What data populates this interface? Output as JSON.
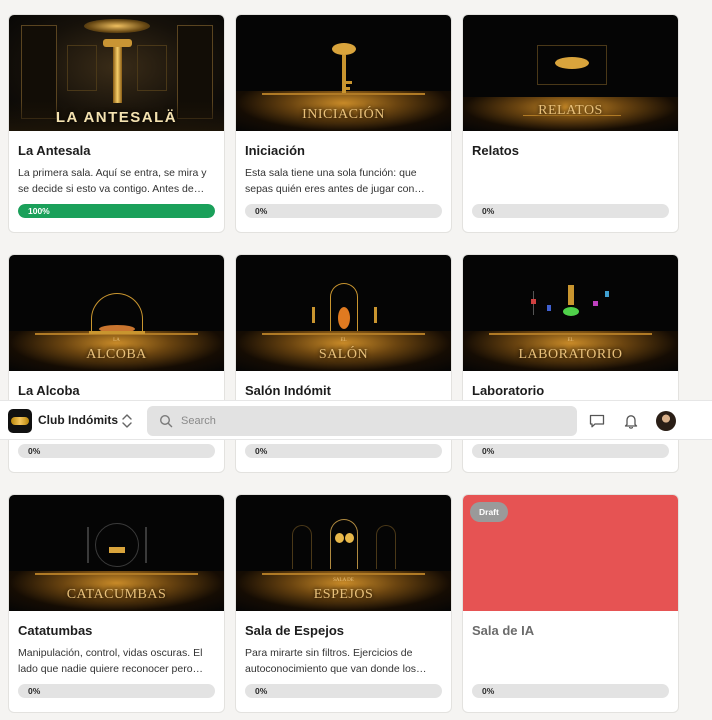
{
  "header": {
    "brand": "Club Indómits",
    "search_placeholder": "Search"
  },
  "cards": [
    {
      "title": "La Antesala",
      "art_label": "LA ANTESALÄ",
      "desc": "La primera sala. Aquí se entra, se mira y se decide si esto va contigo. Antes de avanzar: entiende dónde estás.",
      "progress": 100,
      "progress_label": "100%"
    },
    {
      "title": "Iniciación",
      "art_label": "INICIACIÓN",
      "desc": "Esta sala tiene una sola función: que sepas quién eres antes de jugar con alguien más.",
      "progress": 0,
      "progress_label": "0%"
    },
    {
      "title": "Relatos",
      "art_label": "RELATOS",
      "desc": "",
      "progress": 0,
      "progress_label": "0%"
    },
    {
      "title": "La Alcoba",
      "art_small": "LA",
      "art_label": "ALCOBA",
      "desc": "",
      "progress": 0,
      "progress_label": "0%"
    },
    {
      "title": "Salón Indómit",
      "art_small": "EL",
      "art_label": "SALÓN",
      "desc": "",
      "progress": 0,
      "progress_label": "0%"
    },
    {
      "title": "Laboratorio",
      "art_small": "EL",
      "art_label": "LABORATORIO",
      "desc": "",
      "progress": 0,
      "progress_label": "0%"
    },
    {
      "title": "Catatumbas",
      "art_label": "CATACUMBAS",
      "desc": "Manipulación, control, vidas oscuras. El lado que nadie quiere reconocer pero tod@s llevamos dentro.",
      "progress": 0,
      "progress_label": "0%"
    },
    {
      "title": "Sala de Espejos",
      "art_small": "SALA DE",
      "art_label": "ESPEJOS",
      "desc": "Para mirarte sin filtros. Ejercicios de autoconocimiento que van donde los otros no llegan.",
      "progress": 0,
      "progress_label": "0%"
    },
    {
      "title": "Sala de IA",
      "badge": "Draft",
      "desc": "",
      "progress": 0,
      "progress_label": "0%"
    }
  ],
  "colors": {
    "progress_complete": "#1aa05a",
    "draft_thumbnail": "#e65353",
    "art_gold": "#e8c07a"
  }
}
